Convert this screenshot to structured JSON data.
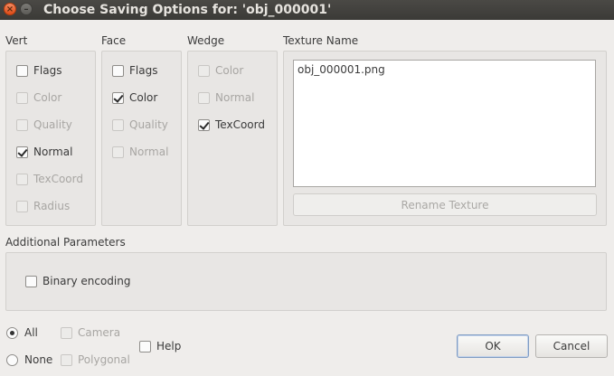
{
  "window": {
    "title": "Choose Saving Options for: 'obj_000001'"
  },
  "vert": {
    "heading": "Vert",
    "items": [
      {
        "label": "Flags",
        "checked": false,
        "enabled": true
      },
      {
        "label": "Color",
        "checked": false,
        "enabled": false
      },
      {
        "label": "Quality",
        "checked": false,
        "enabled": false
      },
      {
        "label": "Normal",
        "checked": true,
        "enabled": true
      },
      {
        "label": "TexCoord",
        "checked": false,
        "enabled": false
      },
      {
        "label": "Radius",
        "checked": false,
        "enabled": false
      }
    ]
  },
  "face": {
    "heading": "Face",
    "items": [
      {
        "label": "Flags",
        "checked": false,
        "enabled": true
      },
      {
        "label": "Color",
        "checked": true,
        "enabled": true
      },
      {
        "label": "Quality",
        "checked": false,
        "enabled": false
      },
      {
        "label": "Normal",
        "checked": false,
        "enabled": false
      }
    ]
  },
  "wedge": {
    "heading": "Wedge",
    "items": [
      {
        "label": "Color",
        "checked": false,
        "enabled": false
      },
      {
        "label": "Normal",
        "checked": false,
        "enabled": false
      },
      {
        "label": "TexCoord",
        "checked": true,
        "enabled": true
      }
    ]
  },
  "texture": {
    "heading": "Texture Name",
    "value": "obj_000001.png",
    "rename_label": "Rename Texture"
  },
  "additional": {
    "heading": "Additional Parameters",
    "binary_label": "Binary encoding",
    "binary_checked": false
  },
  "bottom": {
    "all_label": "All",
    "none_label": "None",
    "camera_label": "Camera",
    "polygonal_label": "Polygonal",
    "help_label": "Help",
    "ok_label": "OK",
    "cancel_label": "Cancel"
  }
}
